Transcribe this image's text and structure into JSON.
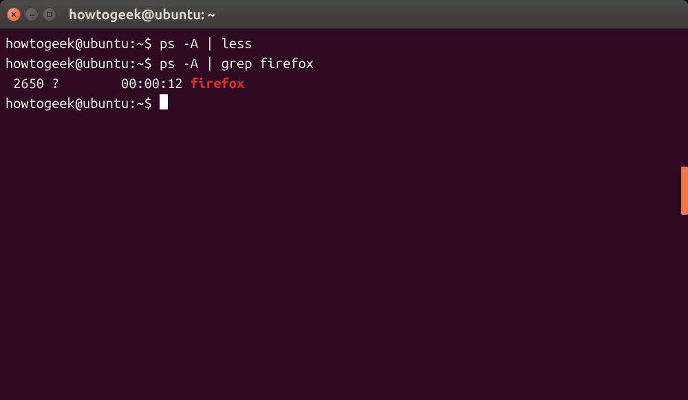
{
  "window": {
    "title": "howtogeek@ubuntu: ~"
  },
  "terminal": {
    "prompt": "howtogeek@ubuntu:~$",
    "lines": {
      "line1_command": " ps -A | less",
      "line2_command": " ps -A | grep firefox",
      "line3_prefix": " 2650 ?        00:00:12 ",
      "line3_highlight": "firefox",
      "line4_command": " "
    }
  }
}
